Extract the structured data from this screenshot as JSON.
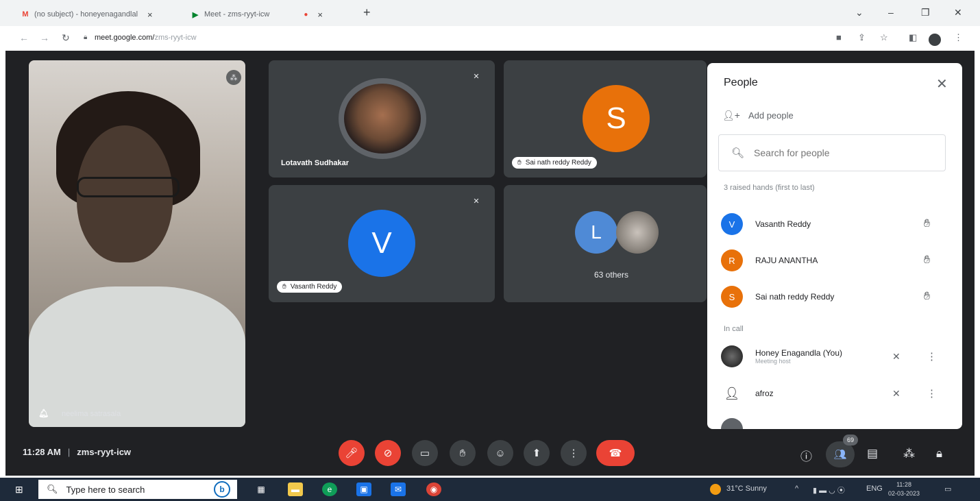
{
  "browser": {
    "tabs": [
      {
        "favicon": "M",
        "title": "(no subject) - honeyenagandlal",
        "close": "×"
      },
      {
        "favicon": "▶",
        "title": "Meet - zms-ryyt-icw",
        "close": "×"
      }
    ],
    "new_tab": "+",
    "url_host": "meet.google.com/",
    "url_path": "zms-ryyt-icw"
  },
  "tiles": {
    "self_name": "neelima satrasala",
    "tile1_name": "Lotavath Sudhakar",
    "tile2_initial": "S",
    "tile2_name": "Sai nath reddy Reddy",
    "tile3_initial": "V",
    "tile3_name": "Vasanth Reddy",
    "tile4_initial": "L",
    "tile4_label": "63 others"
  },
  "colors": {
    "orange": "#e8710a",
    "blue": "#1a73e8",
    "light_blue": "#4f8ad6",
    "red": "#ea4335"
  },
  "people_panel": {
    "title": "People",
    "add_people": "Add people",
    "search_placeholder": "Search for people",
    "raised_header": "3 raised hands (first to last)",
    "raised": [
      {
        "initial": "V",
        "name": "Vasanth Reddy"
      },
      {
        "initial": "R",
        "name": "RAJU ANANTHA"
      },
      {
        "initial": "S",
        "name": "Sai nath reddy Reddy"
      }
    ],
    "in_call_header": "In call",
    "in_call": [
      {
        "name": "Honey Enagandla (You)",
        "sub": "Meeting host"
      },
      {
        "name": "afroz"
      }
    ]
  },
  "bottom_bar": {
    "time": "11:28 AM",
    "separator": "|",
    "meeting_code": "zms-ryyt-icw",
    "participant_count": "69"
  },
  "taskbar": {
    "search_placeholder": "Type here to search",
    "weather": "31°C  Sunny",
    "lang": "ENG",
    "time": "11:28",
    "date": "02-03-2023"
  }
}
